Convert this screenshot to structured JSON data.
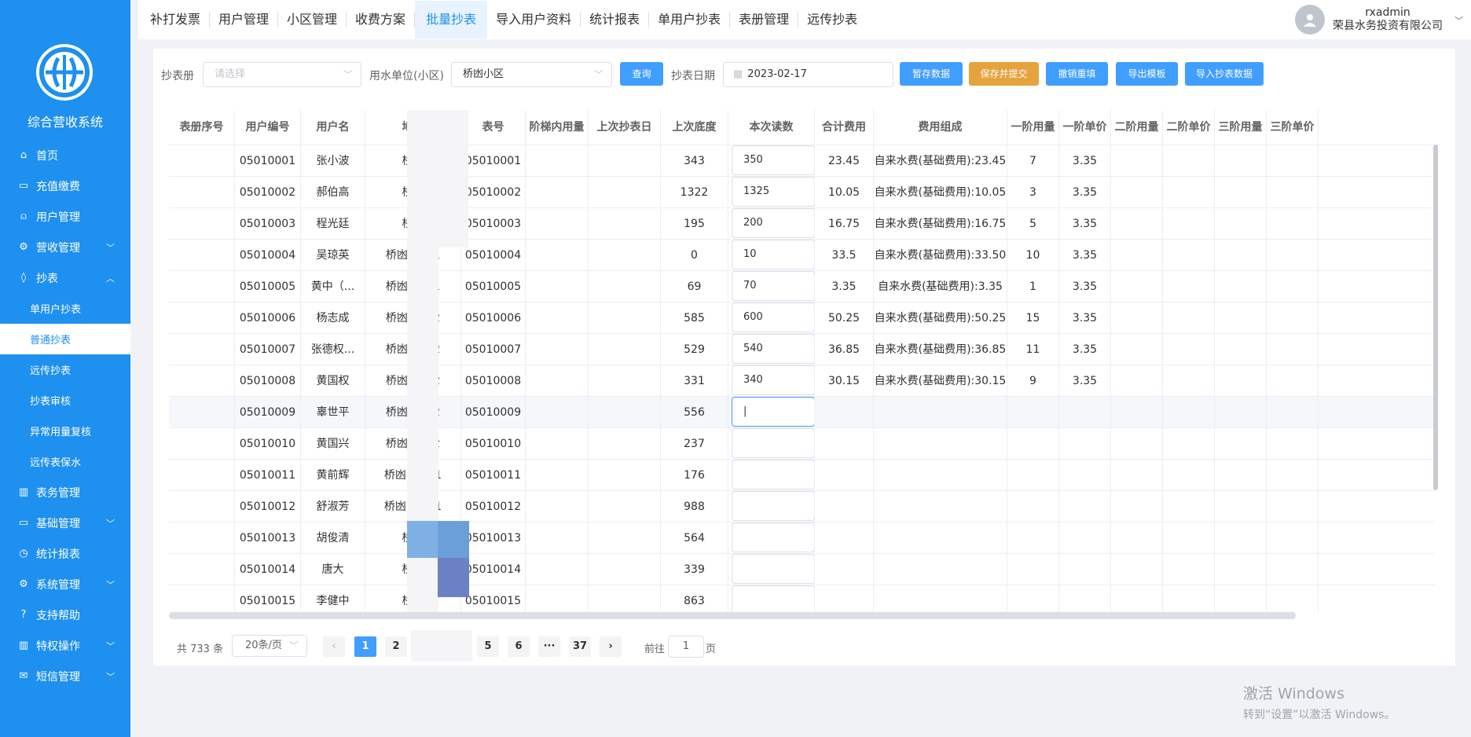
{
  "sidebar": {
    "title": "综合营收系统",
    "items": [
      {
        "label": "首页",
        "icon": "home-icon"
      },
      {
        "label": "充值缴费",
        "icon": "folder-icon"
      },
      {
        "label": "用户管理",
        "icon": "user-icon"
      },
      {
        "label": "营收管理",
        "icon": "gear-icon"
      },
      {
        "label": "抄表",
        "icon": "drop-icon"
      }
    ],
    "sub_items": [
      "单用户抄表",
      "普通抄表",
      "远传抄表",
      "抄表审核",
      "异常用量复核",
      "远传表保水"
    ],
    "items2": [
      {
        "label": "表务管理",
        "icon": "chart-icon"
      },
      {
        "label": "基础管理",
        "icon": "folder-icon"
      },
      {
        "label": "统计报表",
        "icon": "clock-icon"
      },
      {
        "label": "系统管理",
        "icon": "settings-icon"
      },
      {
        "label": "支持帮助",
        "icon": "help-icon"
      },
      {
        "label": "特权操作",
        "icon": "chart-icon"
      },
      {
        "label": "短信管理",
        "icon": "mail-icon"
      }
    ]
  },
  "tabs": [
    "补打发票",
    "用户管理",
    "小区管理",
    "收费方案",
    "批量抄表",
    "导入用户资料",
    "统计报表",
    "单用户抄表",
    "表册管理",
    "远传抄表"
  ],
  "active_tab": "批量抄表",
  "user": {
    "name": "rxadmin",
    "company": "荣县水务投资有限公司"
  },
  "filters": {
    "book_label": "抄表册",
    "book_placeholder": "请选择",
    "unit_label": "用水单位(小区)",
    "unit_value": "桥凼小区",
    "query_btn": "查询",
    "date_label": "抄表日期",
    "date_value": "2023-02-17",
    "buttons": [
      "暂存数据",
      "保存并提交",
      "撤销重填",
      "导出模板",
      "导入抄表数据"
    ]
  },
  "table": {
    "columns": [
      "表册序号",
      "用户编号",
      "用户名",
      "地址",
      "表号",
      "阶梯内用量",
      "上次抄表日",
      "上次底度",
      "本次读数",
      "合计费用",
      "费用组成",
      "一阶用量",
      "一阶单价",
      "二阶用量",
      "二阶单价",
      "三阶用量",
      "三阶单价"
    ],
    "rows": [
      {
        "id": "05010001",
        "name": "张小波",
        "addr": "桥凼",
        "meter": "05010001",
        "last": "343",
        "cur": "350",
        "total": "23.45",
        "fee": "自来水费(基础费用):23.45",
        "q1": "7",
        "p1": "3.35"
      },
      {
        "id": "05010002",
        "name": "郝伯高",
        "addr": "桥凼",
        "meter": "05010002",
        "last": "1322",
        "cur": "1325",
        "total": "10.05",
        "fee": "自来水费(基础费用):10.05",
        "q1": "3",
        "p1": "3.35"
      },
      {
        "id": "05010003",
        "name": "程光廷",
        "addr": "桥凼",
        "meter": "05010003",
        "last": "195",
        "cur": "200",
        "total": "16.75",
        "fee": "自来水费(基础费用):16.75",
        "q1": "5",
        "p1": "3.35"
      },
      {
        "id": "05010004",
        "name": "吴琼英",
        "addr": "桥凼 --501",
        "meter": "05010004",
        "last": "0",
        "cur": "10",
        "total": "33.5",
        "fee": "自来水费(基础费用):33.50",
        "q1": "10",
        "p1": "3.35"
      },
      {
        "id": "05010005",
        "name": "黄中（...",
        "addr": "桥凼 --601",
        "meter": "05010005",
        "last": "69",
        "cur": "70",
        "total": "3.35",
        "fee": "自来水费(基础费用):3.35",
        "q1": "1",
        "p1": "3.35"
      },
      {
        "id": "05010006",
        "name": "杨志成",
        "addr": "桥凼 --202",
        "meter": "05010006",
        "last": "585",
        "cur": "600",
        "total": "50.25",
        "fee": "自来水费(基础费用):50.25",
        "q1": "15",
        "p1": "3.35"
      },
      {
        "id": "05010007",
        "name": "张德权...",
        "addr": "桥凼 --302",
        "meter": "05010007",
        "last": "529",
        "cur": "540",
        "total": "36.85",
        "fee": "自来水费(基础费用):36.85",
        "q1": "11",
        "p1": "3.35"
      },
      {
        "id": "05010008",
        "name": "黄国权",
        "addr": "桥凼 --402",
        "meter": "05010008",
        "last": "331",
        "cur": "340",
        "total": "30.15",
        "fee": "自来水费(基础费用):30.15",
        "q1": "9",
        "p1": "3.35"
      },
      {
        "id": "05010009",
        "name": "辜世平",
        "addr": "桥凼 --502",
        "meter": "05010009",
        "last": "556",
        "cur": "|",
        "total": "",
        "fee": "",
        "q1": "",
        "p1": ""
      },
      {
        "id": "05010010",
        "name": "黄国兴",
        "addr": "桥凼 --602",
        "meter": "05010010",
        "last": "237",
        "cur": "",
        "total": "",
        "fee": "",
        "q1": "",
        "p1": ""
      },
      {
        "id": "05010011",
        "name": "黄前辉",
        "addr": "桥凼 2-201",
        "meter": "05010011",
        "last": "176",
        "cur": "",
        "total": "",
        "fee": "",
        "q1": "",
        "p1": ""
      },
      {
        "id": "05010012",
        "name": "舒淑芳",
        "addr": "桥凼 2-301",
        "meter": "05010012",
        "last": "988",
        "cur": "",
        "total": "",
        "fee": "",
        "q1": "",
        "p1": ""
      },
      {
        "id": "05010013",
        "name": "胡俊清",
        "addr": "桥凼",
        "meter": "05010013",
        "last": "564",
        "cur": "",
        "total": "",
        "fee": "",
        "q1": "",
        "p1": ""
      },
      {
        "id": "05010014",
        "name": "唐大",
        "addr": "桥凼",
        "meter": "05010014",
        "last": "339",
        "cur": "",
        "total": "",
        "fee": "",
        "q1": "",
        "p1": ""
      },
      {
        "id": "05010015",
        "name": "李健中",
        "addr": "桥凼",
        "meter": "05010015",
        "last": "863",
        "cur": "",
        "total": "",
        "fee": "",
        "q1": "",
        "p1": ""
      }
    ]
  },
  "pager": {
    "total": "共 733 条",
    "size": "20条/页",
    "pages": [
      "1",
      "2",
      "5",
      "6",
      "···",
      "37"
    ],
    "goto_label": "前往",
    "goto_value": "1",
    "goto_suffix": "页"
  },
  "watermark": {
    "line1": "激活 Windows",
    "line2": "转到“设置”以激活 Windows。"
  }
}
